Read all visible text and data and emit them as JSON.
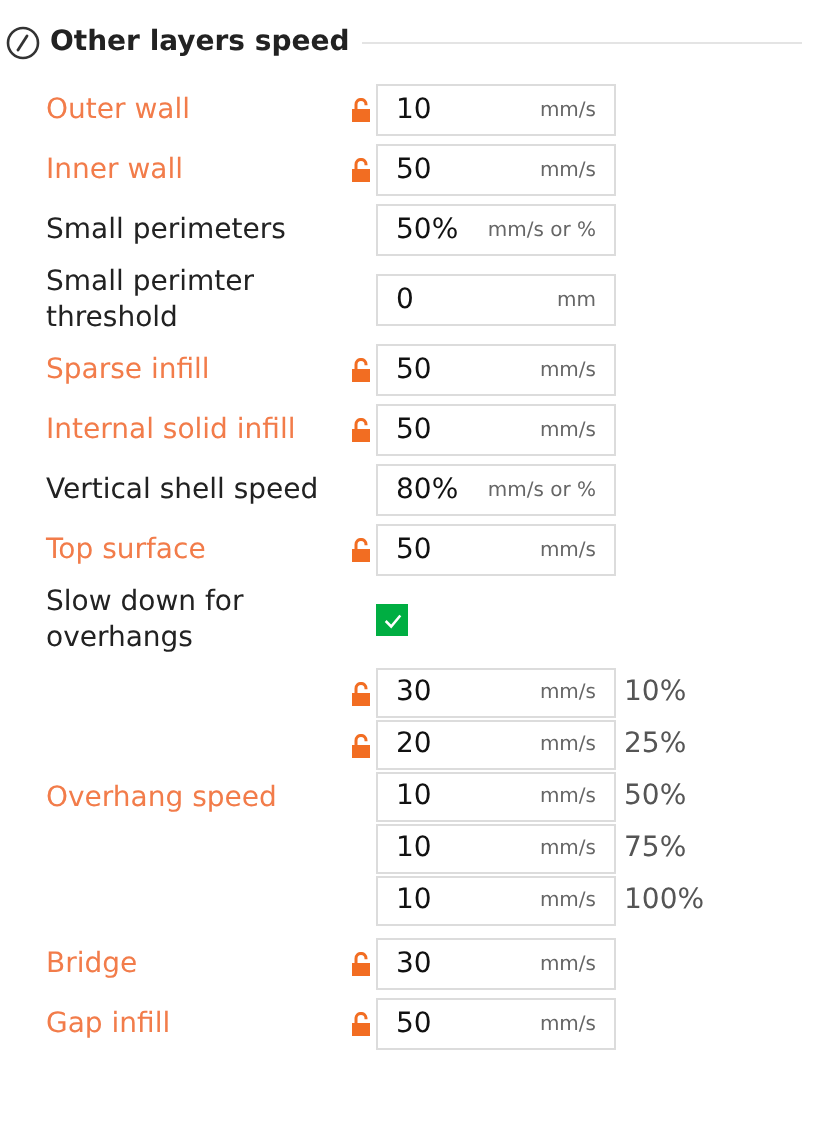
{
  "section": {
    "title": "Other layers speed"
  },
  "rows": [
    {
      "kind": "field",
      "label": "Outer wall",
      "modified": true,
      "value": "10",
      "unit": "mm/s"
    },
    {
      "kind": "field",
      "label": "Inner wall",
      "modified": true,
      "value": "50",
      "unit": "mm/s"
    },
    {
      "kind": "field",
      "label": "Small perimeters",
      "modified": false,
      "value": "50%",
      "unit": "mm/s or %"
    },
    {
      "kind": "field",
      "label": "Small perimter threshold",
      "modified": false,
      "value": "0",
      "unit": "mm"
    },
    {
      "kind": "field",
      "label": "Sparse infill",
      "modified": true,
      "value": "50",
      "unit": "mm/s"
    },
    {
      "kind": "field",
      "label": "Internal solid infill",
      "modified": true,
      "value": "50",
      "unit": "mm/s"
    },
    {
      "kind": "field",
      "label": "Vertical shell speed",
      "modified": false,
      "value": "80%",
      "unit": "mm/s or %"
    },
    {
      "kind": "field",
      "label": "Top surface",
      "modified": true,
      "value": "50",
      "unit": "mm/s"
    },
    {
      "kind": "checkbox",
      "label": "Slow down for overhangs",
      "modified": false,
      "checked": true
    },
    {
      "kind": "group",
      "label": "Overhang speed",
      "modified": true,
      "fields": [
        {
          "modified": true,
          "value": "30",
          "unit": "mm/s",
          "suffix": "10%"
        },
        {
          "modified": true,
          "value": "20",
          "unit": "mm/s",
          "suffix": "25%"
        },
        {
          "modified": false,
          "value": "10",
          "unit": "mm/s",
          "suffix": "50%"
        },
        {
          "modified": false,
          "value": "10",
          "unit": "mm/s",
          "suffix": "75%"
        },
        {
          "modified": false,
          "value": "10",
          "unit": "mm/s",
          "suffix": "100%"
        }
      ]
    },
    {
      "kind": "field",
      "label": "Bridge",
      "modified": true,
      "value": "30",
      "unit": "mm/s"
    },
    {
      "kind": "field",
      "label": "Gap infill",
      "modified": true,
      "value": "50",
      "unit": "mm/s"
    }
  ]
}
